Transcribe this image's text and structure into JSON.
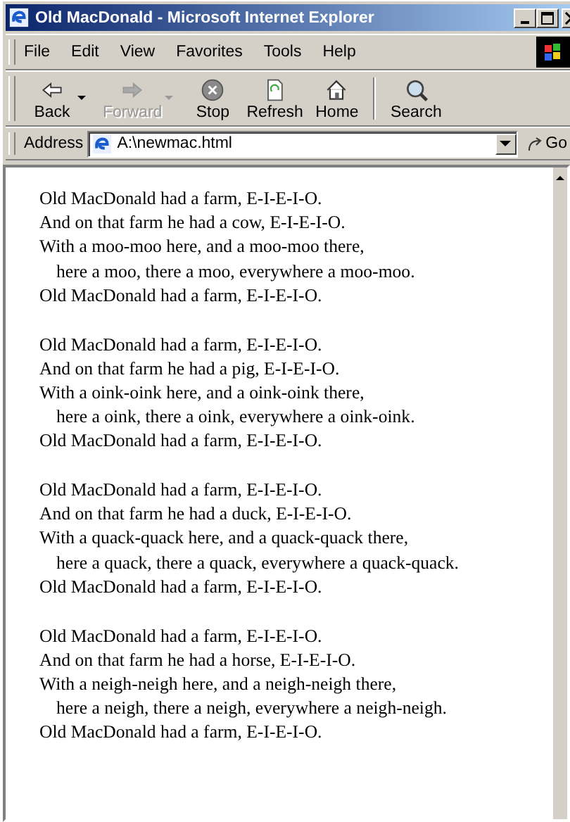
{
  "window": {
    "title": "Old MacDonald - Microsoft Internet Explorer"
  },
  "menu": [
    "File",
    "Edit",
    "View",
    "Favorites",
    "Tools",
    "Help"
  ],
  "toolbar": [
    {
      "label": "Back",
      "kind": "back",
      "disabled": false,
      "dropdown": true
    },
    {
      "label": "Forward",
      "kind": "forward",
      "disabled": true,
      "dropdown": true
    },
    {
      "label": "Stop",
      "kind": "stop",
      "disabled": false,
      "dropdown": false
    },
    {
      "label": "Refresh",
      "kind": "refresh",
      "disabled": false,
      "dropdown": false
    },
    {
      "label": "Home",
      "kind": "home",
      "disabled": false,
      "dropdown": false
    },
    {
      "label": "Search",
      "kind": "search",
      "disabled": false,
      "dropdown": false
    }
  ],
  "address": {
    "label": "Address",
    "value": "A:\\newmac.html",
    "go": "Go"
  },
  "stanzas": [
    {
      "lines": [
        {
          "text": "Old MacDonald had a farm, E-I-E-I-O.",
          "indent": false
        },
        {
          "text": "And on that farm he had a cow, E-I-E-I-O.",
          "indent": false
        },
        {
          "text": "With a moo-moo here, and a moo-moo there,",
          "indent": false
        },
        {
          "text": "here a moo, there a moo, everywhere a moo-moo.",
          "indent": true
        },
        {
          "text": "Old MacDonald had a farm, E-I-E-I-O.",
          "indent": false
        }
      ]
    },
    {
      "lines": [
        {
          "text": "Old MacDonald had a farm, E-I-E-I-O.",
          "indent": false
        },
        {
          "text": "And on that farm he had a pig, E-I-E-I-O.",
          "indent": false
        },
        {
          "text": "With a oink-oink here, and a oink-oink there,",
          "indent": false
        },
        {
          "text": "here a oink, there a oink, everywhere a oink-oink.",
          "indent": true
        },
        {
          "text": "Old MacDonald had a farm, E-I-E-I-O.",
          "indent": false
        }
      ]
    },
    {
      "lines": [
        {
          "text": "Old MacDonald had a farm, E-I-E-I-O.",
          "indent": false
        },
        {
          "text": "And on that farm he had a duck, E-I-E-I-O.",
          "indent": false
        },
        {
          "text": "With a quack-quack here, and a quack-quack there,",
          "indent": false
        },
        {
          "text": "here a quack, there a quack, everywhere a quack-quack.",
          "indent": true
        },
        {
          "text": "Old MacDonald had a farm, E-I-E-I-O.",
          "indent": false
        }
      ]
    },
    {
      "lines": [
        {
          "text": "Old MacDonald had a farm, E-I-E-I-O.",
          "indent": false
        },
        {
          "text": "And on that farm he had a horse, E-I-E-I-O.",
          "indent": false
        },
        {
          "text": "With a neigh-neigh here, and a neigh-neigh there,",
          "indent": false
        },
        {
          "text": "here a neigh, there a neigh, everywhere a neigh-neigh.",
          "indent": true
        },
        {
          "text": "Old MacDonald had a farm, E-I-E-I-O.",
          "indent": false
        }
      ]
    }
  ]
}
